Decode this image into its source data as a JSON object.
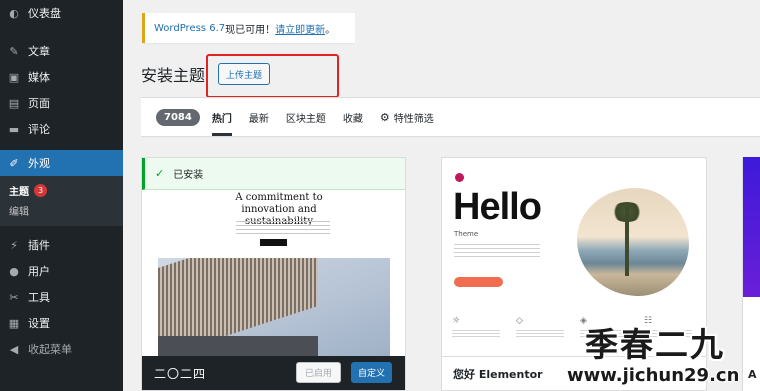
{
  "sidebar": {
    "dashboard": "仪表盘",
    "posts": "文章",
    "media": "媒体",
    "pages": "页面",
    "comments": "评论",
    "appearance": "外观",
    "themes": "主题",
    "themes_badge": "3",
    "editor": "编辑",
    "plugins": "插件",
    "users": "用户",
    "tools": "工具",
    "settings": "设置",
    "collapse": "收起菜单"
  },
  "notice": {
    "version_link": "WordPress 6.7",
    "text": " 现已可用！",
    "update_link": "请立即更新",
    "end": "。"
  },
  "page": {
    "title": "安装主题",
    "upload_button": "上传主题"
  },
  "filter": {
    "count": "7084",
    "tabs": [
      "热门",
      "最新",
      "区块主题",
      "收藏"
    ],
    "feature_filter": "特性筛选"
  },
  "card1": {
    "installed_label": "已安装",
    "screenshot_heading": "A commitment to innovation and sustainability",
    "name": "二〇二四",
    "activated_button": "已启用",
    "customize_button": "自定义"
  },
  "card2": {
    "screenshot_title": "Hello",
    "screenshot_subtitle": "Theme",
    "name": "您好 Elementor"
  },
  "card3": {
    "name_initial": "A"
  },
  "watermark": {
    "brand": "季春二九",
    "url": "www.jichun29.cn"
  },
  "colors": {
    "sidebar_bg": "#1d2327",
    "accent": "#2271b1",
    "badge": "#d63638",
    "installed": "#00a32a",
    "notice_border": "#dba617",
    "highlight": "#e02424"
  }
}
